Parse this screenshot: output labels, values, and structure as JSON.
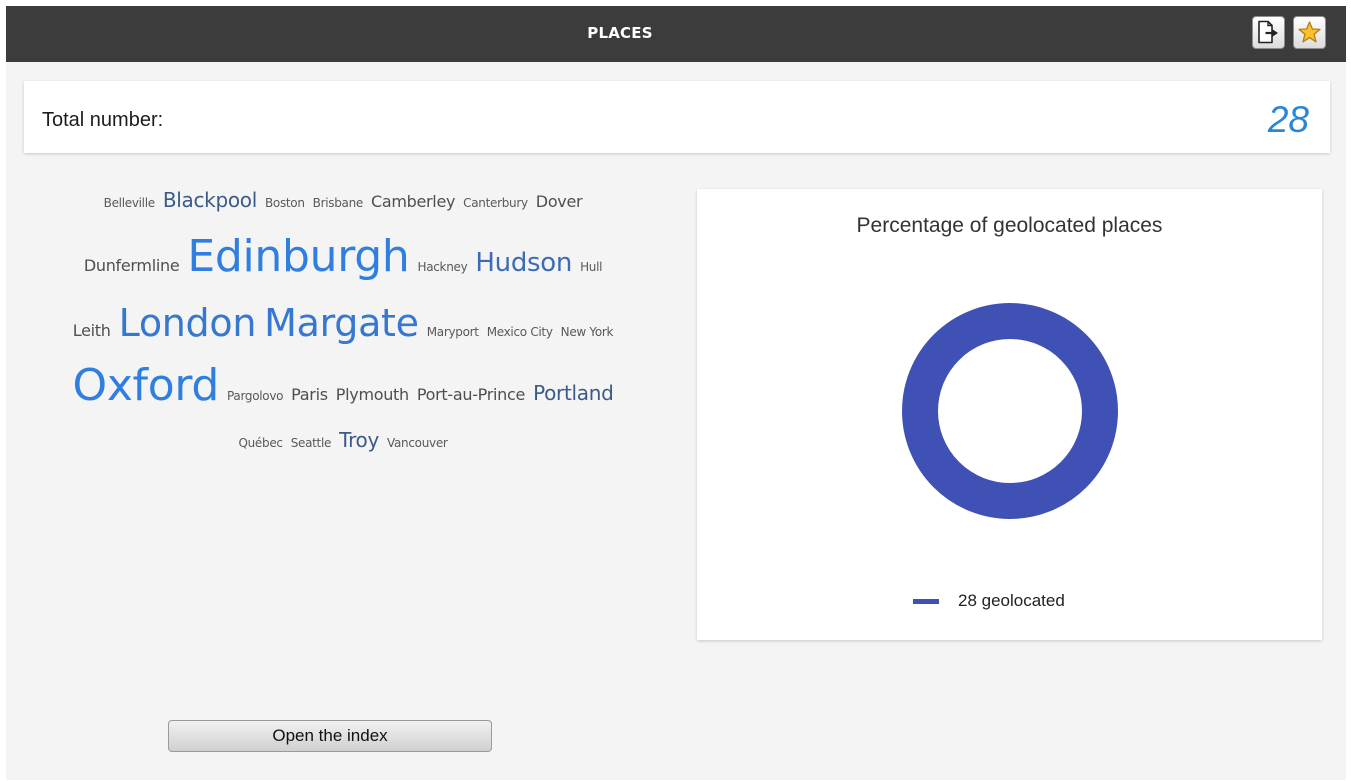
{
  "header": {
    "title": "PLACES",
    "buttons": [
      {
        "icon": "export-icon"
      },
      {
        "icon": "star-icon"
      }
    ]
  },
  "total": {
    "label": "Total number:",
    "value": "28"
  },
  "word_cloud": {
    "words": [
      {
        "text": "Belleville",
        "size": 1
      },
      {
        "text": "Blackpool",
        "size": 3
      },
      {
        "text": "Boston",
        "size": 1
      },
      {
        "text": "Brisbane",
        "size": 1
      },
      {
        "text": "Camberley",
        "size": 2
      },
      {
        "text": "Canterbury",
        "size": 1
      },
      {
        "text": "Dover",
        "size": 2
      },
      {
        "text": "Dunfermline",
        "size": 2
      },
      {
        "text": "Edinburgh",
        "size": 6
      },
      {
        "text": "Hackney",
        "size": 1
      },
      {
        "text": "Hudson",
        "size": 4
      },
      {
        "text": "Hull",
        "size": 1
      },
      {
        "text": "Leith",
        "size": 2
      },
      {
        "text": "London",
        "size": 5
      },
      {
        "text": "Margate",
        "size": 5
      },
      {
        "text": "Maryport",
        "size": 1
      },
      {
        "text": "Mexico City",
        "size": 1
      },
      {
        "text": "New York",
        "size": 1
      },
      {
        "text": "Oxford",
        "size": 6
      },
      {
        "text": "Pargolovo",
        "size": 1
      },
      {
        "text": "Paris",
        "size": 2
      },
      {
        "text": "Plymouth",
        "size": 2
      },
      {
        "text": "Port-au-Prince",
        "size": 2
      },
      {
        "text": "Portland",
        "size": 3
      },
      {
        "text": "Québec",
        "size": 1
      },
      {
        "text": "Seattle",
        "size": 1
      },
      {
        "text": "Troy",
        "size": 3
      },
      {
        "text": "Vancouver",
        "size": 1
      }
    ]
  },
  "chart_data": {
    "type": "pie",
    "style": "donut",
    "title": "Percentage of geolocated places",
    "categories": [
      "28 geolocated"
    ],
    "values": [
      28
    ],
    "colors": [
      "#3f51b5"
    ],
    "legend_position": "bottom"
  },
  "open_index": {
    "label": "Open the index"
  }
}
